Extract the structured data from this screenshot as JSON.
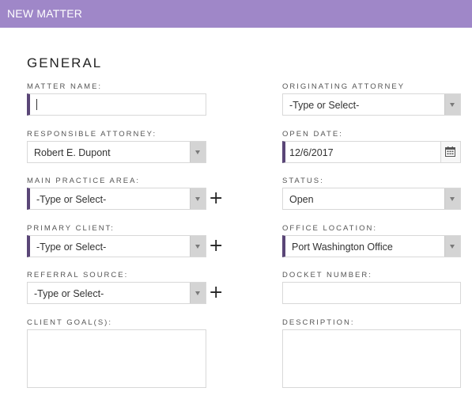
{
  "window": {
    "title": "NEW MATTER"
  },
  "section": {
    "title": "GENERAL"
  },
  "fields": {
    "matter_name": {
      "label": "MATTER NAME:",
      "value": ""
    },
    "originating_attorney": {
      "label": "ORIGINATING ATTORNEY",
      "value": "-Type or Select-"
    },
    "responsible_attorney": {
      "label": "RESPONSIBLE ATTORNEY:",
      "value": "Robert E. Dupont"
    },
    "open_date": {
      "label": "OPEN DATE:",
      "value": "12/6/2017"
    },
    "main_practice_area": {
      "label": "MAIN PRACTICE AREA:",
      "value": "-Type or Select-"
    },
    "status": {
      "label": "STATUS:",
      "value": "Open"
    },
    "primary_client": {
      "label": "PRIMARY CLIENT:",
      "value": "-Type or Select-"
    },
    "office_location": {
      "label": "OFFICE LOCATION:",
      "value": "Port Washington Office"
    },
    "referral_source": {
      "label": "REFERRAL SOURCE:",
      "value": "-Type or Select-"
    },
    "docket_number": {
      "label": "DOCKET NUMBER:",
      "value": ""
    },
    "client_goals": {
      "label": "CLIENT GOAL(S):",
      "value": ""
    },
    "description": {
      "label": "DESCRIPTION:",
      "value": ""
    }
  },
  "icons": {
    "add": "+",
    "calendar": "calendar-icon",
    "dropdown": "chevron-down-icon"
  },
  "colors": {
    "titlebar": "#9f87c8",
    "required_marker": "#5a4677"
  }
}
